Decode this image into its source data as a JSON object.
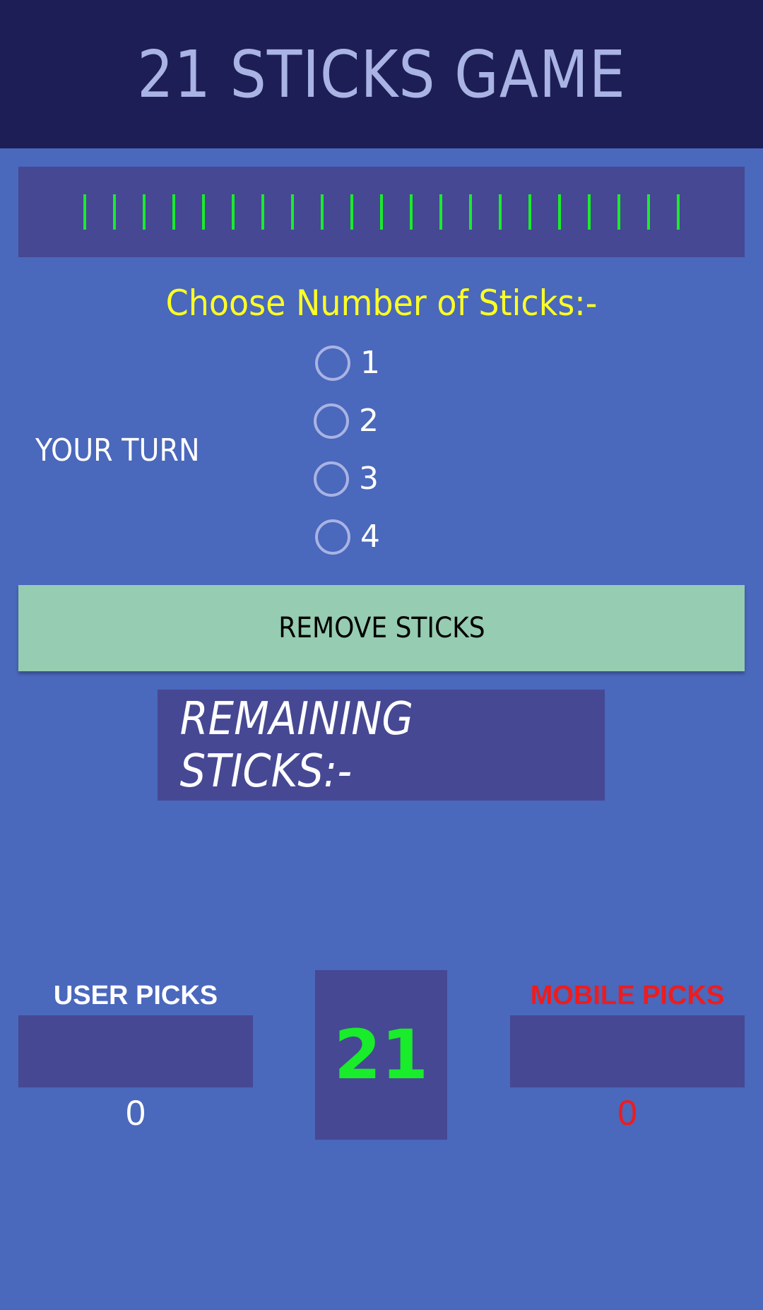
{
  "header": {
    "title": "21 STICKS GAME"
  },
  "sticks": {
    "count": 21,
    "color": "#19ec2a"
  },
  "choose": {
    "label": "Choose Number of Sticks:-"
  },
  "turn": {
    "label": "YOUR TURN"
  },
  "options": [
    {
      "label": "1",
      "selected": false
    },
    {
      "label": "2",
      "selected": false
    },
    {
      "label": "3",
      "selected": false
    },
    {
      "label": "4",
      "selected": false
    }
  ],
  "remove_button": {
    "label": "REMOVE STICKS"
  },
  "remaining": {
    "label": "REMAINING STICKS:-"
  },
  "user": {
    "label": "USER PICKS",
    "count": "0"
  },
  "center": {
    "count": "21"
  },
  "mobile": {
    "label": "MOBILE PICKS",
    "count": "0"
  },
  "colors": {
    "header_bg": "#1e1e56",
    "page_bg": "#4a68bc",
    "panel_bg": "#464893",
    "button_bg": "#96ccb1",
    "accent_yellow": "#ffff22",
    "accent_green": "#19ec2a",
    "accent_red": "#ee1c1c"
  }
}
